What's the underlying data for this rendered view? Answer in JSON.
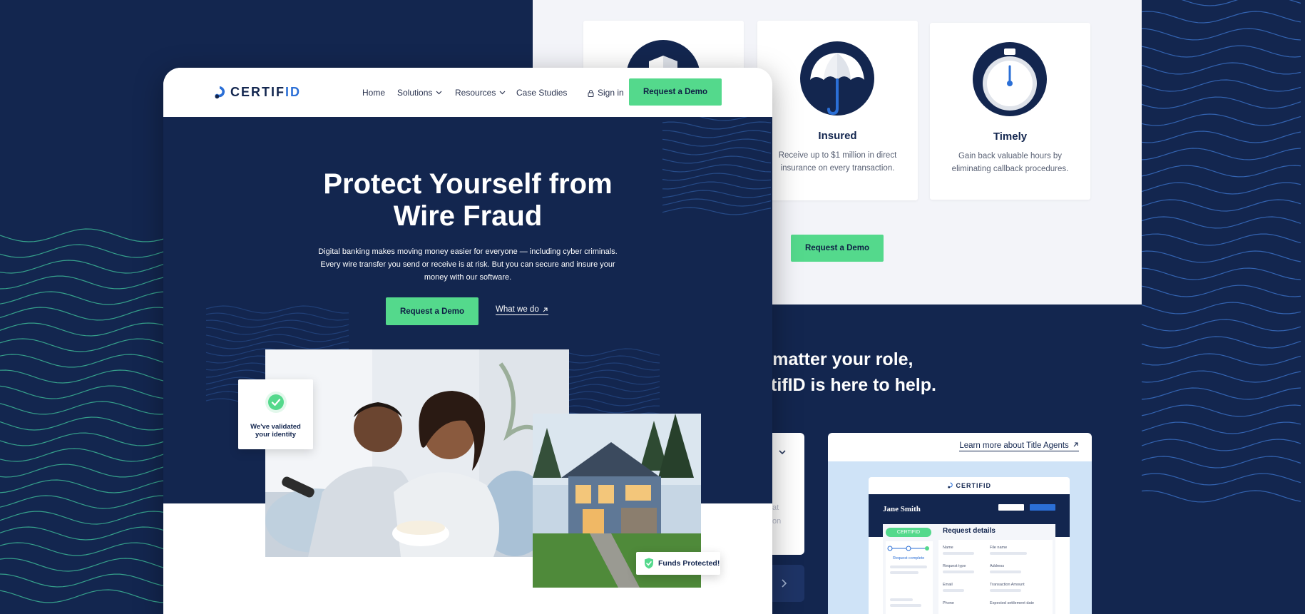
{
  "nav": {
    "brand_prefix": "CERTIF",
    "brand_suffix": "ID",
    "home": "Home",
    "solutions": "Solutions",
    "resources": "Resources",
    "case_studies": "Case Studies",
    "sign_in": "Sign in",
    "cta": "Request a Demo"
  },
  "hero": {
    "title_line1": "Protect Yourself from",
    "title_line2": "Wire Fraud",
    "subtitle_line1": "Digital banking makes moving money easier for everyone — including cyber criminals.",
    "subtitle_line2": "Every wire transfer you send or receive is at risk. But you can secure and insure your",
    "subtitle_line3": "money with our software.",
    "cta": "Request a Demo",
    "link": "What we do"
  },
  "badges": {
    "validated_line1": "We've validated",
    "validated_line2": "your identity",
    "funds": "Funds Protected!"
  },
  "features": [
    {
      "title": "Insured",
      "desc_line1": "Receive up to $1 million in direct",
      "desc_line2": "insurance on every transaction."
    },
    {
      "title": "Timely",
      "desc_line1": "Gain back valuable hours by",
      "desc_line2": "eliminating callback procedures."
    }
  ],
  "back": {
    "cta": "Request a Demo",
    "help_line1": "o matter your role,",
    "help_line2": "tifID is here to help.",
    "role_ghost1": "at",
    "role_ghost2": "on"
  },
  "agent": {
    "link": "Learn more about Title Agents",
    "mock_brand": "CERTIFID",
    "mock_name": "Jane Smith",
    "mock_badge": "CERTIFID",
    "mock_title": "Request details",
    "mock_status": "Request complete",
    "fields": [
      "Name",
      "File name",
      "Request type",
      "Address",
      "Email",
      "Transaction Amount",
      "Phone",
      "Expected settlement date"
    ]
  },
  "colors": {
    "navy": "#13264f",
    "green": "#54d98c",
    "blue": "#2b6fd6",
    "wave_teal": "#3fbf9a",
    "wave_blue": "#3a6fc2"
  },
  "icons": [
    "shield-icon",
    "umbrella-icon",
    "stopwatch-icon",
    "lock-icon",
    "chevron-down-icon",
    "external-arrow-icon",
    "checkmark-icon",
    "chevron-right-icon"
  ]
}
